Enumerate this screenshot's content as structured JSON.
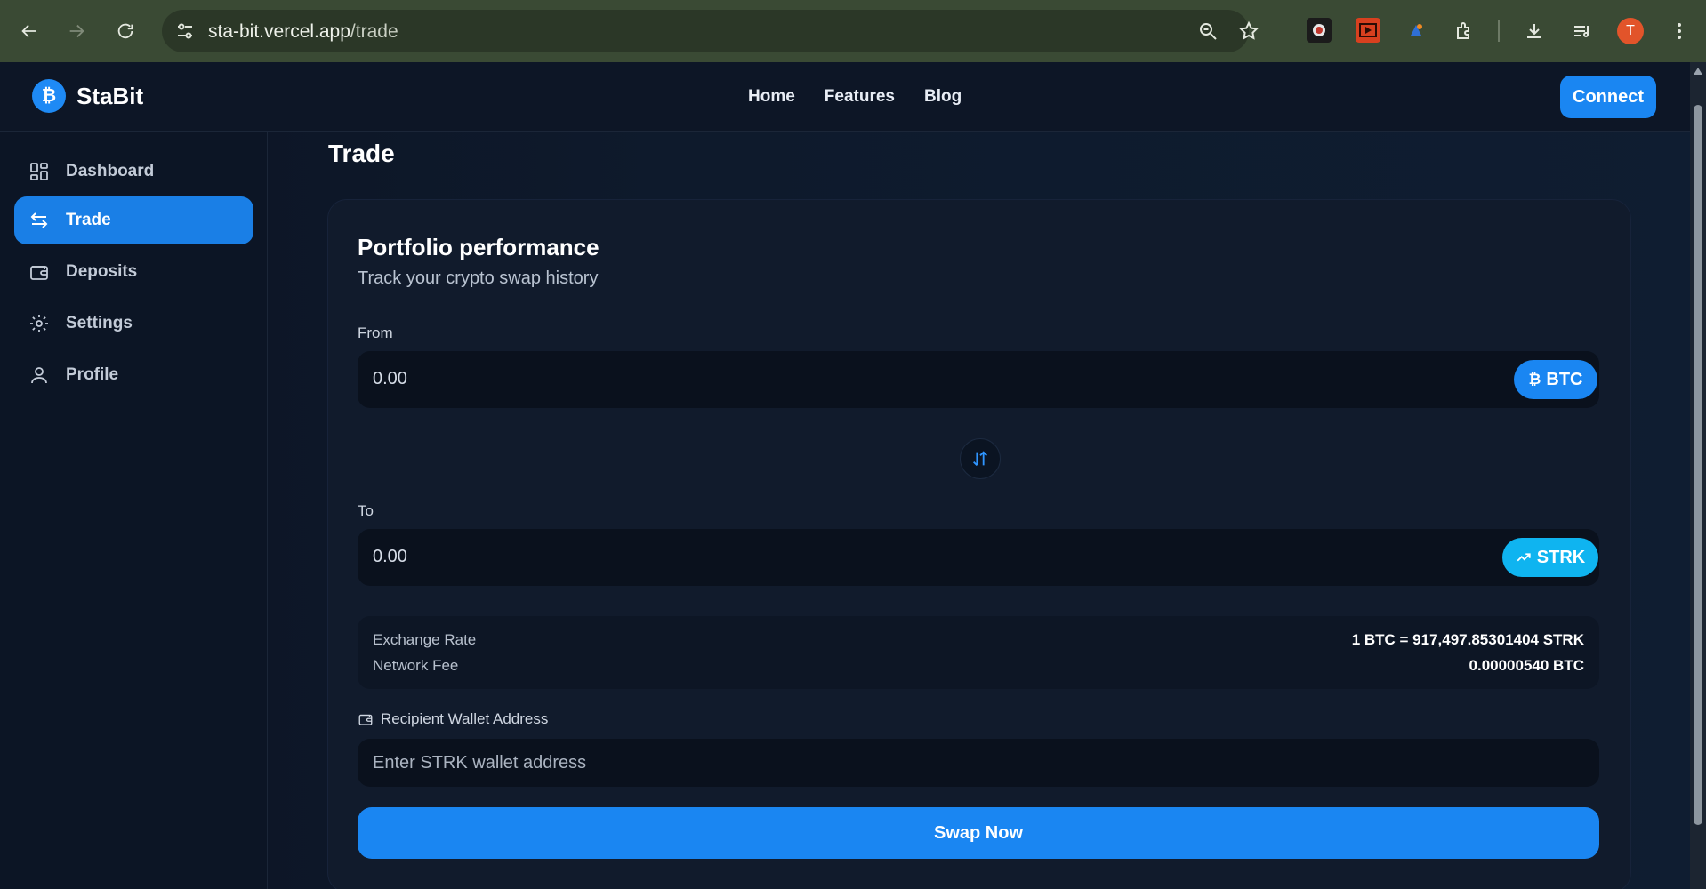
{
  "browser": {
    "url_host": "sta-bit.vercel.app",
    "url_path": "/trade",
    "profile_initial": "T"
  },
  "brand": {
    "logo_glyph": "₿",
    "name": "StaBit"
  },
  "topnav": [
    "Home",
    "Features",
    "Blog"
  ],
  "connect_label": "Connect",
  "sidebar": {
    "items": [
      {
        "label": "Dashboard",
        "icon": "dashboard-icon",
        "active": false
      },
      {
        "label": "Trade",
        "icon": "swap-arrows-icon",
        "active": true
      },
      {
        "label": "Deposits",
        "icon": "wallet-icon",
        "active": false
      },
      {
        "label": "Settings",
        "icon": "gear-icon",
        "active": false
      },
      {
        "label": "Profile",
        "icon": "user-icon",
        "active": false
      }
    ]
  },
  "page": {
    "title": "Trade",
    "card": {
      "title": "Portfolio performance",
      "subtitle": "Track your crypto swap history",
      "from": {
        "label": "From",
        "value": "0.00",
        "token": "BTC",
        "token_glyph": "₿"
      },
      "to": {
        "label": "To",
        "value": "0.00",
        "token": "STRK"
      },
      "info": {
        "exchange_rate_label": "Exchange Rate",
        "exchange_rate_value": "1 BTC = 917,497.85301404 STRK",
        "network_fee_label": "Network Fee",
        "network_fee_value": "0.00000540 BTC"
      },
      "wallet": {
        "label": "Recipient Wallet Address",
        "placeholder": "Enter STRK wallet address"
      },
      "swap_label": "Swap Now"
    }
  },
  "colors": {
    "accent": "#1a86f2",
    "strk_accent": "#0fb4f0",
    "background": "#0b1220"
  }
}
